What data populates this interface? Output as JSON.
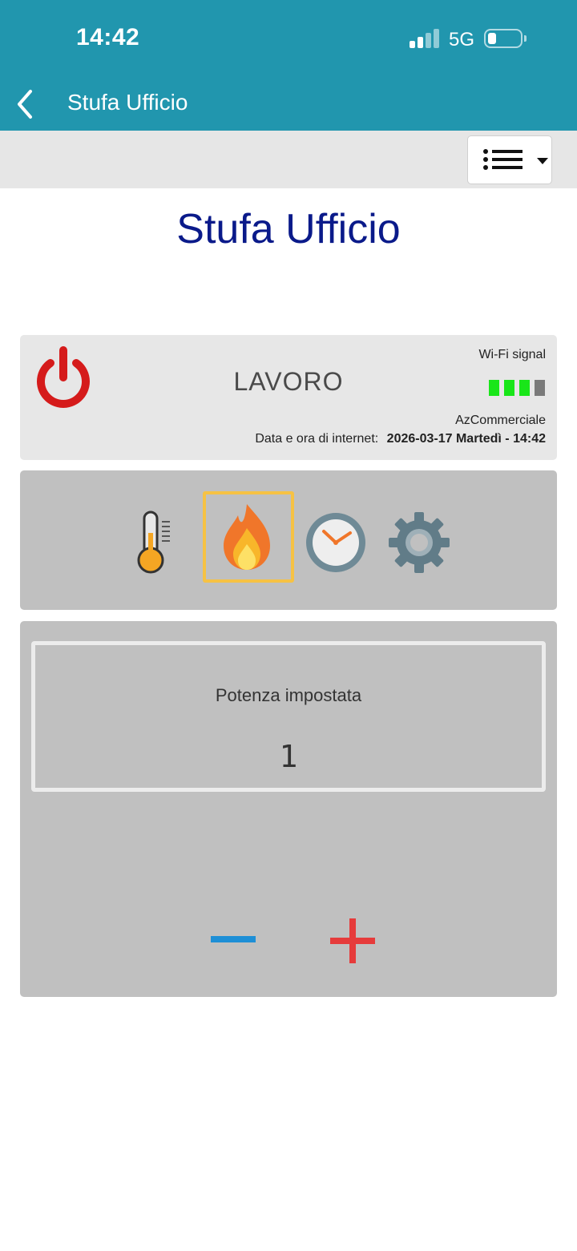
{
  "status_bar": {
    "time": "14:42",
    "network": "5G"
  },
  "nav": {
    "title": "Stufa Ufficio"
  },
  "page": {
    "title": "Stufa Ufficio"
  },
  "status": {
    "mode": "LAVORO",
    "wifi_label": "Wi-Fi signal",
    "wifi_strength": {
      "bars_active": 3,
      "bars_total": 4
    },
    "company": "AzCommerciale",
    "datetime_label": "Data e ora di internet:",
    "datetime_value": "2026-03-17 Martedì - 14:42"
  },
  "tabs": [
    {
      "name": "thermometer-icon",
      "selected": false
    },
    {
      "name": "flame-icon",
      "selected": true
    },
    {
      "name": "clock-icon",
      "selected": false
    },
    {
      "name": "gear-icon",
      "selected": false
    }
  ],
  "power": {
    "label": "Potenza impostata",
    "value": "1"
  },
  "colors": {
    "header": "#2196ae",
    "title": "#0a1a8a",
    "power_icon": "#d51b1b",
    "wifi_active": "#19e619",
    "wifi_inactive": "#7a7a7a",
    "tab_highlight": "#f6c244",
    "minus": "#1e8fd6",
    "plus": "#e63b3b"
  }
}
